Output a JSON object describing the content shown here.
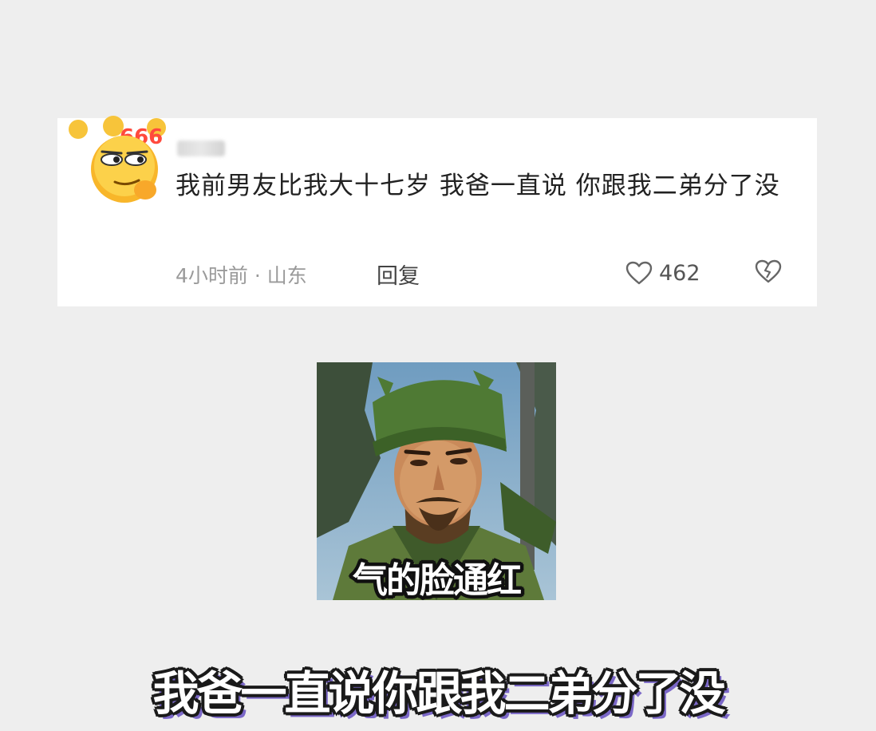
{
  "comment": {
    "avatar_badge": "666",
    "text": "我前男友比我大十七岁 我爸一直说 你跟我二弟分了没",
    "time_location": "4小时前 · 山东",
    "reply_label": "回复",
    "like_count": "462",
    "icons": {
      "avatar": "smirk-emoji-avatar-icon",
      "like": "heart-outline-icon",
      "dislike": "broken-heart-icon"
    }
  },
  "meme": {
    "caption": "气的脸通红"
  },
  "subtitle": "我爸一直说你跟我二弟分了没",
  "colors": {
    "background": "#eeeeee",
    "card": "#ffffff",
    "subtitle_shadow": "#7b68c8"
  }
}
